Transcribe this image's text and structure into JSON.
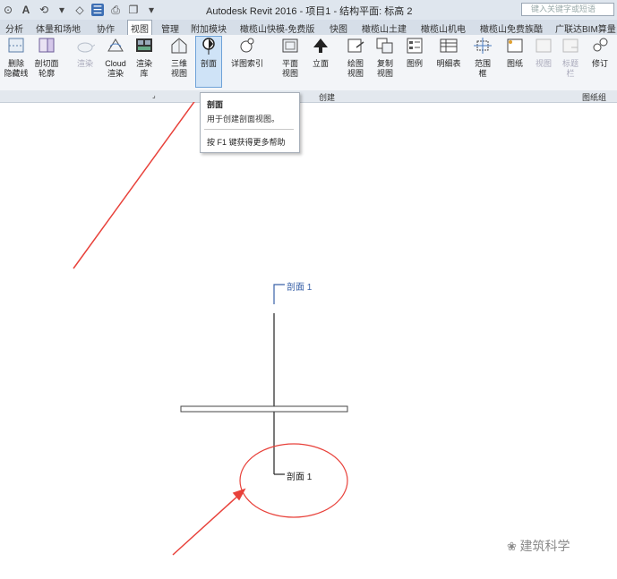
{
  "app": {
    "title": "Autodesk Revit 2016 -    项目1 - 结构平面: 标高 2",
    "search_placeholder": "键入关键字或短语"
  },
  "tabs": [
    {
      "label": "分析"
    },
    {
      "label": "体量和场地"
    },
    {
      "label": "协作"
    },
    {
      "label": "视图",
      "active": true
    },
    {
      "label": "管理"
    },
    {
      "label": "附加模块"
    },
    {
      "label": "橄榄山快模-免费版"
    },
    {
      "label": "快图"
    },
    {
      "label": "橄榄山土建"
    },
    {
      "label": "橄榄山机电"
    },
    {
      "label": "橄榄山免费族酷"
    },
    {
      "label": "广联达BIM算量"
    }
  ],
  "ribbon": {
    "buttons": {
      "delete_hidden": "删除\n隐藏线",
      "section_profile": "剖切面\n轮廓",
      "render": "渲染",
      "cloud_render": "Cloud\n渲染",
      "render_gallery": "渲染\n库",
      "view_3d": "三维\n视图",
      "section": "剖面",
      "callout": "详图索引",
      "plan_view": "平面\n视图",
      "elevation": "立面",
      "drafting_view": "绘图\n视图",
      "duplicate_view": "复制\n视图",
      "legend": "图例",
      "schedule": "明细表",
      "scope_box": "范围\n框",
      "sheet": "图纸",
      "view": "视图",
      "title_block": "标题\n栏",
      "revision": "修订"
    },
    "panels": {
      "create": "创建",
      "sheet_composition": "图纸组"
    }
  },
  "tooltip": {
    "title": "剖面",
    "description": "用于创建剖面视图。",
    "help": "按 F1 键获得更多帮助"
  },
  "drawing": {
    "section_label_top": "剖面 1",
    "section_label_bottom": "剖面 1"
  },
  "watermark": "建筑科学",
  "colors": {
    "annotation_arrow": "#e8413a",
    "highlight": "#cfe3f7",
    "section_blue": "#3a62a8"
  }
}
